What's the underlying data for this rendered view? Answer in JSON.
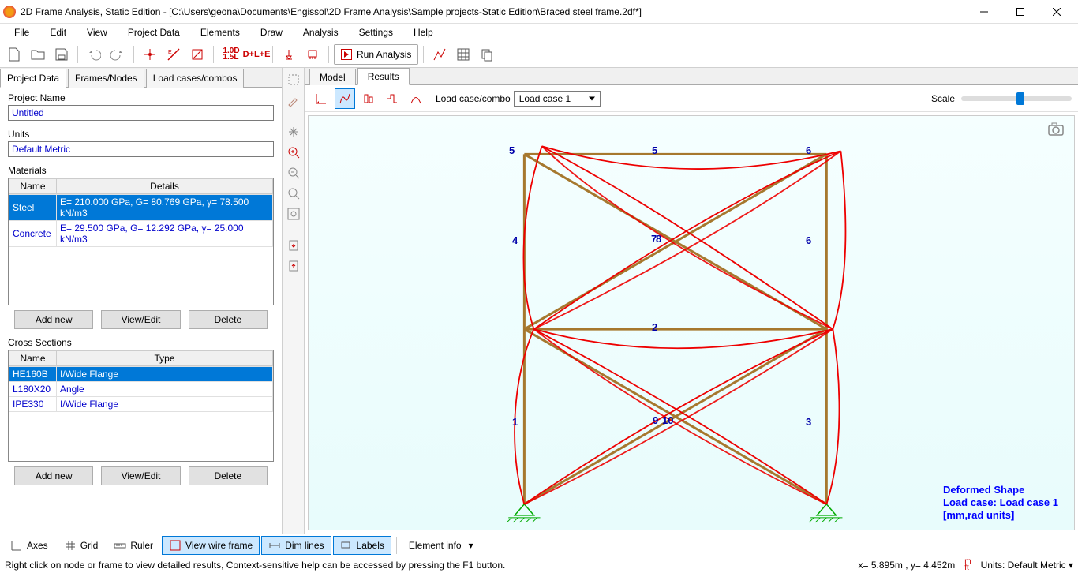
{
  "title": "2D Frame Analysis, Static Edition - [C:\\Users\\geona\\Documents\\Engissol\\2D Frame Analysis\\Sample projects-Static Edition\\Braced steel frame.2df*]",
  "menu": [
    "File",
    "Edit",
    "View",
    "Project Data",
    "Elements",
    "Draw",
    "Analysis",
    "Settings",
    "Help"
  ],
  "runAnalysis": "Run Analysis",
  "leftTabs": [
    "Project Data",
    "Frames/Nodes",
    "Load cases/combos"
  ],
  "projectName": {
    "label": "Project Name",
    "value": "Untitled"
  },
  "units": {
    "label": "Units",
    "value": "Default Metric"
  },
  "materials": {
    "title": "Materials",
    "headers": [
      "Name",
      "Details"
    ],
    "rows": [
      {
        "name": "Steel",
        "details": "E= 210.000 GPa, G= 80.769 GPa, γ= 78.500 kN/m3",
        "sel": true
      },
      {
        "name": "Concrete",
        "details": "E= 29.500 GPa, G= 12.292 GPa, γ= 25.000 kN/m3"
      }
    ]
  },
  "xsections": {
    "title": "Cross Sections",
    "headers": [
      "Name",
      "Type"
    ],
    "rows": [
      {
        "name": "HE160B",
        "type": "I/Wide Flange",
        "sel": true
      },
      {
        "name": "L180X20",
        "type": "Angle"
      },
      {
        "name": "IPE330",
        "type": "I/Wide Flange"
      }
    ]
  },
  "buttons": {
    "add": "Add new",
    "edit": "View/Edit",
    "del": "Delete"
  },
  "viewTabs": [
    "Model",
    "Results"
  ],
  "loadCaseLabel": "Load case/combo",
  "loadCaseValue": "Load case 1",
  "scaleLabel": "Scale",
  "nodeLabels": [
    "1",
    "2",
    "3",
    "4",
    "5",
    "5",
    "6",
    "6",
    "7",
    "8",
    "9",
    "10"
  ],
  "infoText": {
    "l1": "Deformed Shape",
    "l2": "Load case: Load case 1",
    "l3": "[mm,rad units]"
  },
  "bottom": {
    "axes": "Axes",
    "grid": "Grid",
    "ruler": "Ruler",
    "wire": "View wire frame",
    "dim": "Dim lines",
    "labels": "Labels",
    "elinfo": "Element info"
  },
  "statusHint": "Right click on node or frame to view detailed results, Context-sensitive help can be accessed by pressing the F1 button.",
  "coords": "x= 5.895m , y= 4.452m",
  "unitsStatus": "Units: Default Metric"
}
